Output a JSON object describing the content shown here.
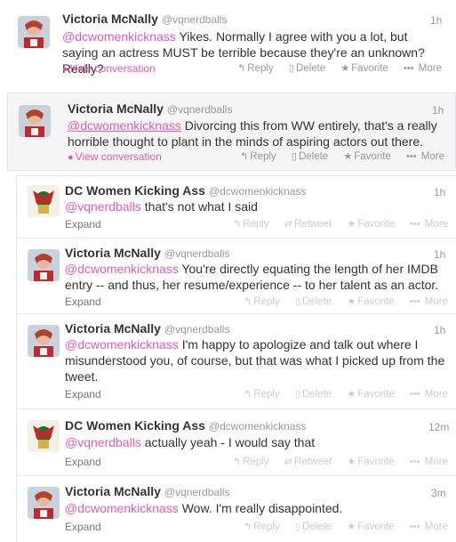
{
  "tweets": [
    {
      "name": "Victoria McNally",
      "handle": "@vqnerdballs",
      "time": "1h",
      "mention": "@dcwomenkicknass",
      "text": " Yikes. Normally I agree with you a lot, but saying an actress MUST be terrible because they're an unknown? Really?",
      "link": "Hide conversation",
      "actions": [
        "Reply",
        "Delete",
        "Favorite",
        "More"
      ]
    },
    {
      "name": "Victoria McNally",
      "handle": "@vqnerdballs",
      "time": "1h",
      "mention": "@dcwomenkicknass",
      "text": " Divorcing this from WW entirely, that's a really horrible thought to plant in the minds of aspiring actors out there.",
      "link": "View conversation",
      "actions": [
        "Reply",
        "Delete",
        "Favorite",
        "More"
      ]
    }
  ],
  "conversation": [
    {
      "name": "DC Women Kicking Ass",
      "handle": "@dcwomenkicknass",
      "time": "1h",
      "mention": "@vqnerdballs",
      "text": " that's not what I said",
      "expand": "Expand",
      "actions": [
        "Reply",
        "Retweet",
        "Favorite",
        "More"
      ]
    },
    {
      "name": "Victoria McNally",
      "handle": "@vqnerdballs",
      "time": "1h",
      "mention": "@dcwomenkicknass",
      "text": " You're directly equating the length of her IMDB entry -- and thus, her resume/experience -- to her talent as an actor.",
      "expand": "Expand",
      "actions": [
        "Reply",
        "Delete",
        "Favorite",
        "More"
      ]
    },
    {
      "name": "Victoria McNally",
      "handle": "@vqnerdballs",
      "time": "1h",
      "mention": "@dcwomenkicknass",
      "text": " I'm happy to apologize and talk out where I misunderstood you, of course, but that was what I picked up from the tweet.",
      "expand": "Expand",
      "actions": [
        "Reply",
        "Delete",
        "Favorite",
        "More"
      ]
    },
    {
      "name": "DC Women Kicking Ass",
      "handle": "@dcwomenkicknass",
      "time": "12m",
      "mention": "@vqnerdballs",
      "text": " actually yeah - I would say that",
      "expand": "Expand",
      "actions": [
        "Reply",
        "Retweet",
        "Favorite",
        "More"
      ]
    },
    {
      "name": "Victoria McNally",
      "handle": "@vqnerdballs",
      "time": "3m",
      "mention": "@dcwomenkicknass",
      "text": " Wow. I'm really disappointed.",
      "expand": "Expand",
      "actions": [
        "Reply",
        "Delete",
        "Favorite",
        "More"
      ]
    }
  ],
  "colors": {
    "mention": "#e05bb8",
    "muted": "#999999"
  },
  "icons": {
    "reply": "reply-icon",
    "delete": "trash-icon",
    "retweet": "retweet-icon",
    "favorite": "star-icon",
    "more": "more-dots-icon",
    "conversation": "speech-bubble-icon"
  }
}
